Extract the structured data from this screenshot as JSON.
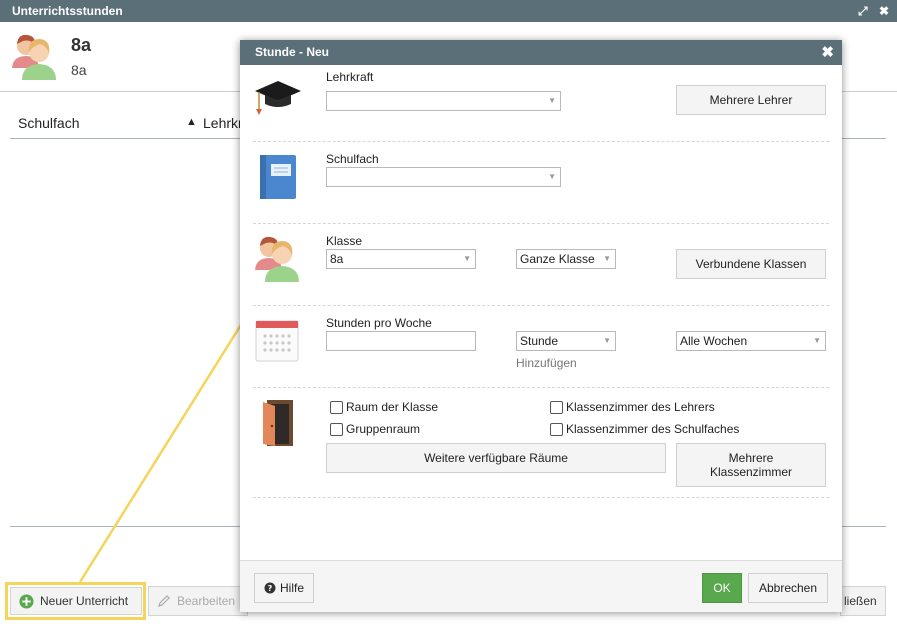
{
  "window": {
    "title": "Unterrichtsstunden",
    "maximize_glyph": "⤢",
    "close_glyph": "✖"
  },
  "header": {
    "class_title": "8a",
    "class_subtitle": "8a"
  },
  "table": {
    "columns": [
      {
        "label": "Schulfach"
      },
      {
        "label": "Lehrkr",
        "sort_glyph": "▲"
      }
    ]
  },
  "bottom_bar": {
    "new_lesson_label": "Neuer Unterricht",
    "edit_label": "Bearbeiten",
    "close_label": "ließen"
  },
  "dialog": {
    "title": "Stunde - Neu",
    "close_glyph": "✖",
    "teacher": {
      "label": "Lehrkraft",
      "value": "",
      "multi_button": "Mehrere Lehrer"
    },
    "subject": {
      "label": "Schulfach",
      "value": ""
    },
    "class": {
      "label": "Klasse",
      "value": "8a",
      "group_value": "Ganze Klasse",
      "linked_button": "Verbundene Klassen"
    },
    "hours": {
      "label": "Stunden pro Woche",
      "value": "",
      "unit_value": "Stunde",
      "weeks_value": "Alle Wochen",
      "add_link": "Hinzufügen"
    },
    "rooms": {
      "checkboxes": [
        {
          "label": "Raum der Klasse",
          "checked": false
        },
        {
          "label": "Klassenzimmer des Lehrers",
          "checked": false
        },
        {
          "label": "Gruppenraum",
          "checked": false
        },
        {
          "label": "Klassenzimmer des Schulfaches",
          "checked": false
        }
      ],
      "more_rooms_button": "Weitere verfügbare Räume",
      "multi_rooms_button": "Mehrere Klassenzimmer"
    },
    "footer": {
      "help_label": "Hilfe",
      "ok_label": "OK",
      "cancel_label": "Abbrechen"
    }
  },
  "colors": {
    "titlebar": "#5b6f79",
    "ok_green": "#5aa84e",
    "annotation_yellow": "#f4d45a"
  },
  "icons": [
    "graduation-cap-icon",
    "book-icon",
    "students-icon",
    "calendar-icon",
    "door-icon",
    "help-icon",
    "plus-circle-icon",
    "pencil-icon"
  ]
}
